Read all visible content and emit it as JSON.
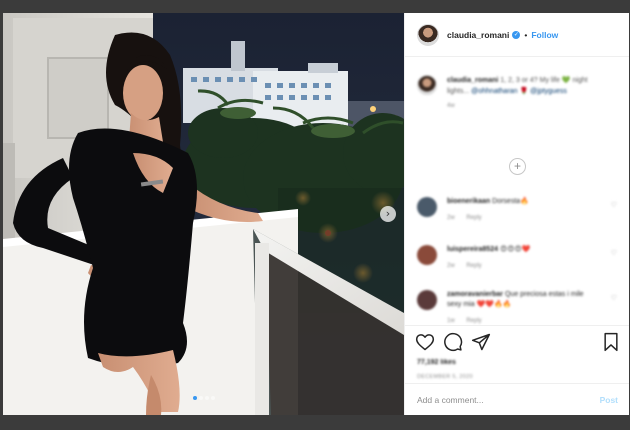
{
  "header": {
    "username": "claudia_romani",
    "verified": true,
    "separator": "•",
    "follow_label": "Follow"
  },
  "caption": {
    "username": "claudia_romani",
    "text": "1, 2, 3 or 4? My life 💚 night lights...",
    "tags": "@ohhnatharan 🌹 @jptyguess",
    "time": "4w",
    "load_more_symbol": "+"
  },
  "comments": [
    {
      "username": "bioenerikaan",
      "text": "Dorsesta🔥",
      "time": "2w",
      "reply_label": "Reply",
      "avatar_color": "#4a5a6a"
    },
    {
      "username": "luispereira8524",
      "text": "😍😍😍❤️",
      "time": "2w",
      "reply_label": "Reply",
      "avatar_color": "#8a4a3a"
    },
    {
      "username": "zamoravanierbar",
      "text": "Que preciosa estas i mile sexy mia ❤️❤️🔥🔥",
      "time": "1w",
      "reply_label": "Reply",
      "avatar_color": "#5a3a3a"
    }
  ],
  "actions": {
    "like_icon": "heart-outline-icon",
    "comment_icon": "comment-bubble-icon",
    "share_icon": "paper-plane-icon",
    "save_icon": "bookmark-icon"
  },
  "likes_text": "77,192 likes",
  "date_text": "DECEMBER 5, 2020",
  "add_comment": {
    "placeholder": "Add a comment...",
    "post_label": "Post"
  },
  "media": {
    "next_symbol": "›",
    "slide_count": 4,
    "active_slide": 1
  },
  "colors": {
    "accent": "#3897f0",
    "post_disabled": "#b2dffc",
    "backdrop": "#3b3b3b"
  }
}
